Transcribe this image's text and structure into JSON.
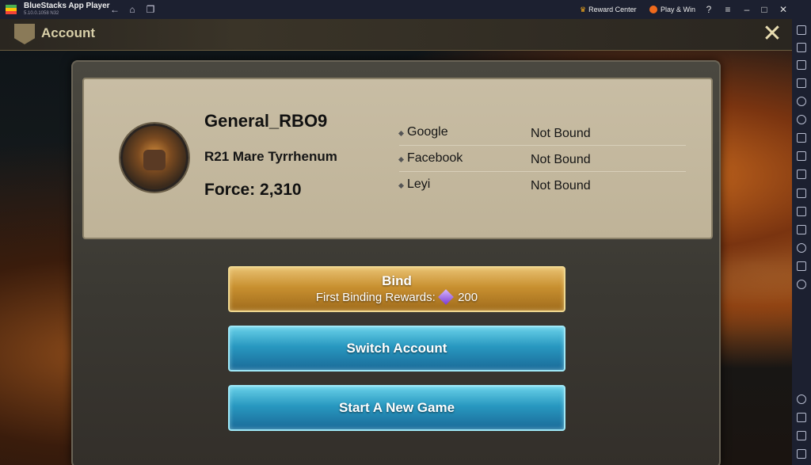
{
  "titlebar": {
    "app_name": "BlueStacks App Player",
    "version": "5.10.0.1058 N32",
    "reward_center": "Reward Center",
    "play_win": "Play & Win"
  },
  "game": {
    "header_title": "Account",
    "player": {
      "name": "General_RBO9",
      "server": "R21 Mare Tyrrhenum",
      "force": "Force: 2,310"
    },
    "bindings": [
      {
        "provider": "Google",
        "status": "Not Bound"
      },
      {
        "provider": "Facebook",
        "status": "Not Bound"
      },
      {
        "provider": "Leyi",
        "status": "Not Bound"
      }
    ],
    "buttons": {
      "bind": "Bind",
      "bind_reward_label": "First Binding Rewards:",
      "bind_reward_amount": "200",
      "switch_account": "Switch Account",
      "start_new_game": "Start A New Game"
    }
  },
  "colors": {
    "titlebar_bg": "#1c2030",
    "bind_button": "#c89030",
    "action_button": "#2898c0"
  }
}
